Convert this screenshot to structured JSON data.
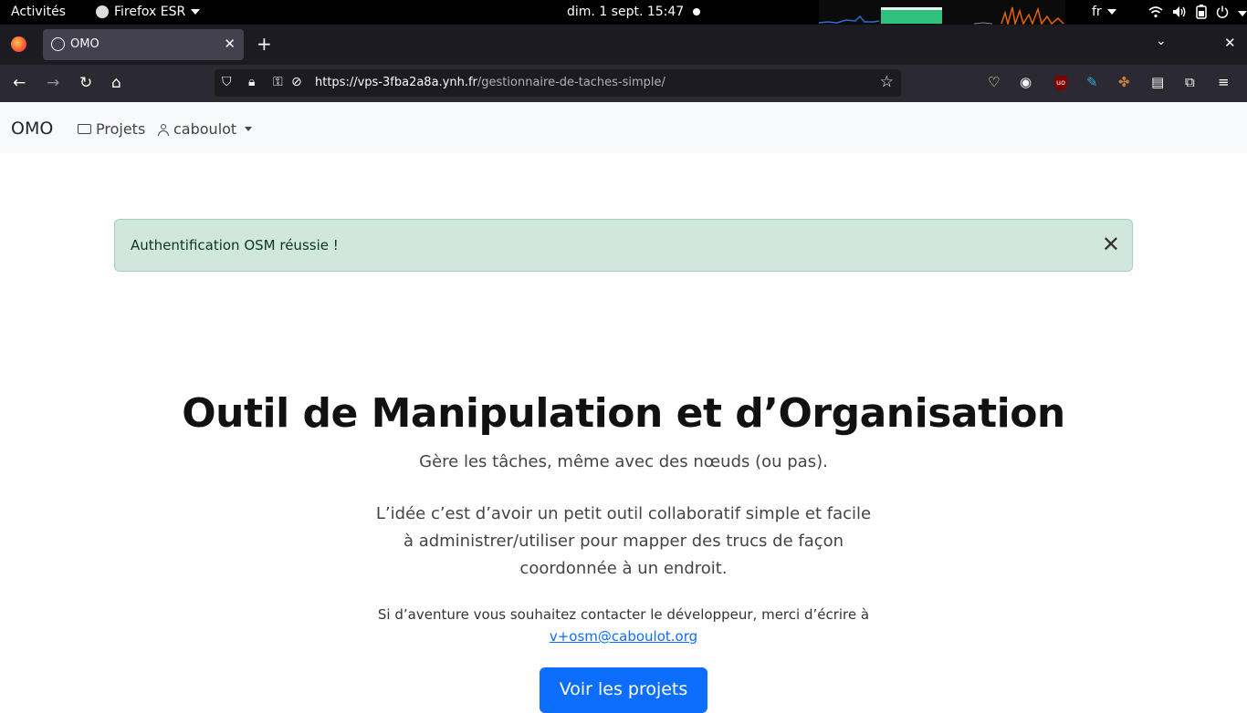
{
  "system": {
    "activities": "Activités",
    "app_name": "Firefox ESR",
    "clock": "dim. 1 sept.  15:47",
    "keyboard_layout": "fr",
    "icons": [
      "wifi-icon",
      "volume-icon",
      "battery-icon",
      "power-icon"
    ]
  },
  "browser": {
    "tab_title": "OMO",
    "url_host": "https://vps-3fba2a8a.ynh.fr",
    "url_path": "/gestionnaire-de-taches-simple/"
  },
  "site": {
    "brand": "OMO",
    "nav_projects": "Projets",
    "nav_user": "caboulot"
  },
  "alert": {
    "message": "Authentification OSM réussie !"
  },
  "hero": {
    "title": "Outil de Manipulation et d’Organisation",
    "lead": "Gère les tâches, même avec des nœuds (ou pas).",
    "description": "L’idée c’est d’avoir un petit outil collaboratif simple et facile à administrer/utiliser pour mapper des trucs de façon coordonnée à un endroit.",
    "contact_text": "Si d’aventure vous souhaitez contacter le développeur, merci d’écrire à",
    "contact_email": "v+osm@caboulot.org",
    "cta_label": "Voir les projets"
  },
  "colors": {
    "primary": "#0d6efd",
    "alert_bg": "#d1e7dd",
    "navbar_bg": "#f8f9fa"
  }
}
